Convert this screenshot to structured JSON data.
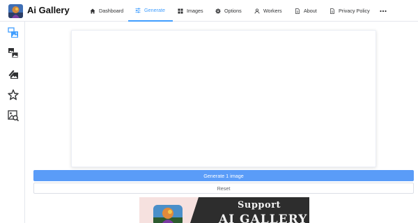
{
  "app": {
    "title": "Ai Gallery"
  },
  "nav": {
    "items": [
      {
        "label": "Dashboard",
        "icon": "home-icon"
      },
      {
        "label": "Generate",
        "icon": "sliders-icon",
        "active": true
      },
      {
        "label": "Images",
        "icon": "grid-icon"
      },
      {
        "label": "Options",
        "icon": "gear-icon"
      },
      {
        "label": "Workers",
        "icon": "user-icon"
      },
      {
        "label": "About",
        "icon": "document-icon"
      },
      {
        "label": "Privacy Policy",
        "icon": "document-icon"
      }
    ],
    "more_icon": "ellipsis-icon"
  },
  "sidebar": {
    "items": [
      {
        "icon": "text-to-image-icon",
        "active": true
      },
      {
        "icon": "image-to-image-icon"
      },
      {
        "icon": "inpainting-icon"
      },
      {
        "icon": "rate-star-icon"
      },
      {
        "icon": "interrogate-image-icon"
      }
    ]
  },
  "main": {
    "generate_label": "Generate 1 image",
    "reset_label": "Reset"
  },
  "banner": {
    "line1": "Support",
    "line2": "AI GALLERY"
  },
  "colors": {
    "accent": "#409eff",
    "generate_button": "#5a9cf8",
    "banner_dark": "#2d2d2d",
    "banner_light": "#f6e1df"
  }
}
